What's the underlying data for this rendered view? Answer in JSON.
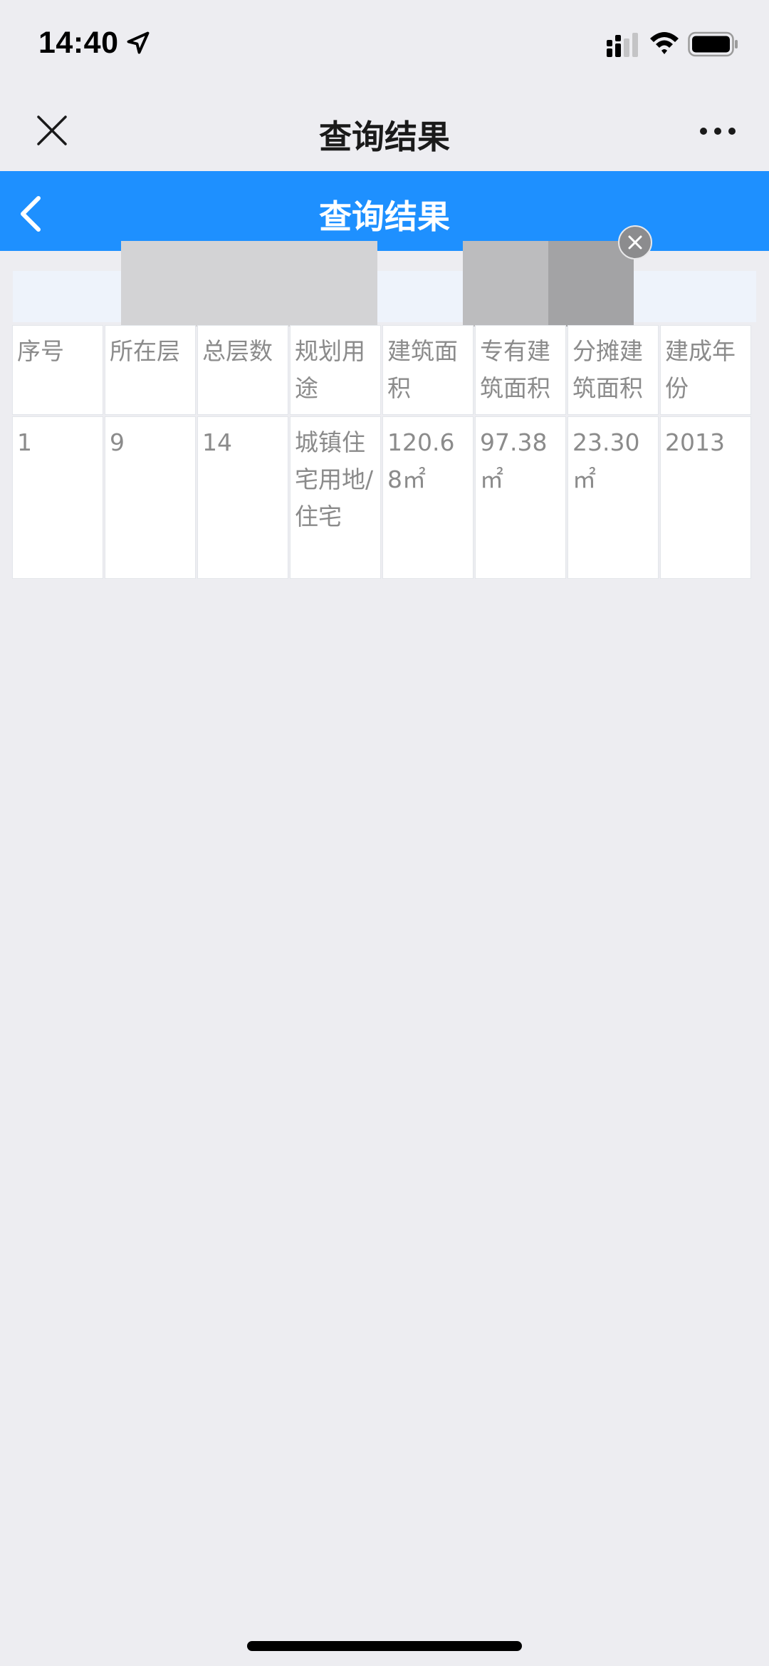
{
  "status_bar": {
    "time": "14:40"
  },
  "wechat_nav": {
    "title": "查询结果"
  },
  "page_header": {
    "title": "查询结果"
  },
  "table": {
    "headers": [
      "序号",
      "所在层",
      "总层数",
      "规划用途",
      "建筑面积",
      "专有建筑面积",
      "分摊建筑面积",
      "建成年份"
    ],
    "rows": [
      [
        "1",
        "9",
        "14",
        "城镇住宅用地/住宅",
        "120.68㎡",
        "97.38㎡",
        "23.30㎡",
        "2013"
      ]
    ]
  },
  "colors": {
    "accent": "#1e90ff",
    "background": "#ededf1",
    "cell_text": "#8b8b8b"
  },
  "icons": [
    "location-arrow-icon",
    "signal-icon",
    "wifi-icon",
    "battery-icon",
    "close-icon",
    "more-icon",
    "back-icon",
    "ad-close-icon"
  ]
}
